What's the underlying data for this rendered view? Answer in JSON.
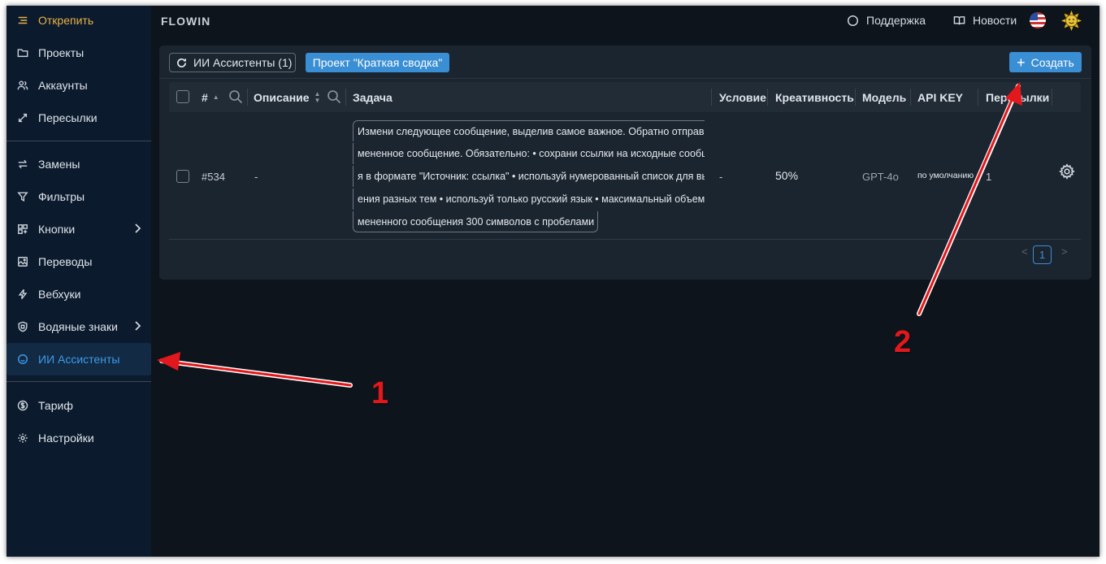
{
  "brand": "FLOWIN",
  "sidebar": {
    "toggle_label": "Открепить",
    "items": [
      {
        "label": "Проекты"
      },
      {
        "label": "Аккаунты"
      },
      {
        "label": "Пересылки"
      },
      {
        "label": "Замены"
      },
      {
        "label": "Фильтры"
      },
      {
        "label": "Кнопки"
      },
      {
        "label": "Переводы"
      },
      {
        "label": "Вебхуки"
      },
      {
        "label": "Водяные знаки"
      },
      {
        "label": "ИИ Ассистенты"
      },
      {
        "label": "Тариф"
      },
      {
        "label": "Настройки"
      }
    ],
    "active_item": "ИИ Ассистенты"
  },
  "header": {
    "support_label": "Поддержка",
    "news_label": "Новости",
    "language_flag": "us-flag-icon",
    "avatar_icon": "sun-avatar-icon"
  },
  "toolbar": {
    "refresh_label": "ИИ Ассистенты (1)",
    "project_label": "Проект \"Краткая сводка\"",
    "create_label": "Создать"
  },
  "table": {
    "columns": [
      "#",
      "Описание",
      "Задача",
      "Условие",
      "Креативность",
      "Модель",
      "API KEY",
      "Пересылки"
    ],
    "rows": [
      {
        "id": "#534",
        "description": "-",
        "task_lines": [
          "Измени следующее сообщение, выделив самое важное. Обратно отправь из",
          "мененное сообщение. Обязательно: • сохрани ссылки на исходные сообщени",
          "я в формате \"Источник: ссылка\" • используй нумерованный список для выдел",
          "ения разных тем • используй только русский язык • максимальный объем изм",
          "мененного сообщения 300 символов с пробелами"
        ],
        "condition": "-",
        "creativity": "50%",
        "model": "GPT-4o",
        "api_key": "по умолчанию",
        "forwards": "1"
      }
    ]
  },
  "pagination": {
    "current_page": "1",
    "prev": "<",
    "next": ">"
  },
  "annotations": {
    "arrow_1_label": "1",
    "arrow_2_label": "2",
    "color": "#e3181c"
  },
  "colors": {
    "accent": "#3a8ed4",
    "sidebar_bg": "#0b1a2c",
    "page_bg": "#0e141b",
    "panel_bg": "#1b2530",
    "toggle": "#e8b24a"
  }
}
